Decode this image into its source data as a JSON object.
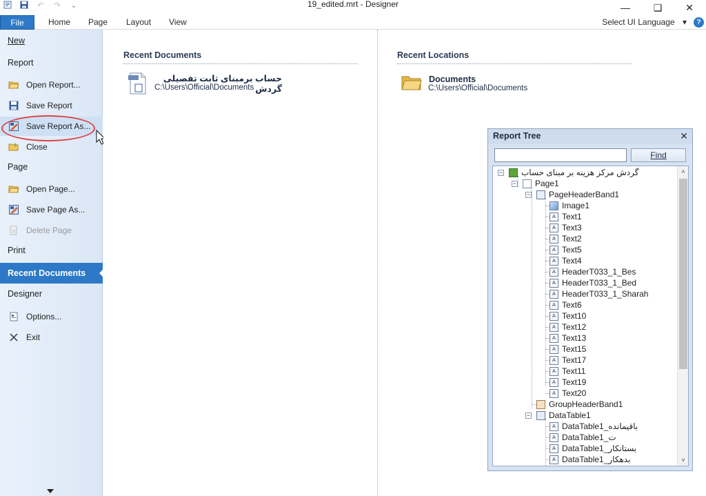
{
  "window": {
    "title": "19_edited.mrt  - Designer",
    "minimize_glyph": "—",
    "maximize_glyph": "❏",
    "close_glyph": "✕"
  },
  "qat": {
    "save_icon": "save-icon",
    "undo_icon": "undo-icon",
    "redo_icon": "redo-icon",
    "customize_glyph": "⌄"
  },
  "ribbon": {
    "tabs": [
      {
        "label": "File"
      },
      {
        "label": "Home"
      },
      {
        "label": "Page"
      },
      {
        "label": "Layout"
      },
      {
        "label": "View"
      }
    ],
    "ui_language": "Select UI Language",
    "ui_language_arrow": "▾",
    "help": "?"
  },
  "backstage": {
    "new": "New",
    "report_header": "Report",
    "open_report": "Open Report...",
    "save_report": "Save Report",
    "save_report_as": "Save Report As...",
    "close": "Close",
    "page_header": "Page",
    "open_page": "Open Page...",
    "save_page_as": "Save Page As...",
    "delete_page": "Delete Page",
    "print": "Print",
    "recent_documents": "Recent Documents",
    "designer_header": "Designer",
    "options": "Options...",
    "exit": "Exit"
  },
  "recent_documents": {
    "title": "Recent Documents",
    "items": [
      {
        "name": "حساب برمبنای ثابت تفصیلی گردش",
        "path": "C:\\Users\\Official\\Documents"
      }
    ]
  },
  "recent_locations": {
    "title": "Recent Locations",
    "items": [
      {
        "name": "Documents",
        "path": "C:\\Users\\Official\\Documents"
      }
    ]
  },
  "report_tree": {
    "title": "Report Tree",
    "close_glyph": "✕",
    "search_value": "",
    "find_label": "Find",
    "nodes": {
      "root": "گردش مرکز هزینه بر مبنای حساب",
      "page1": "Page1",
      "page_header_band": "PageHeaderBand1",
      "image1": "Image1",
      "text1": "Text1",
      "text3": "Text3",
      "text2": "Text2",
      "text5": "Text5",
      "text4": "Text4",
      "header_bes": "HeaderT033_1_Bes",
      "header_bed": "HeaderT033_1_Bed",
      "header_sharah": "HeaderT033_1_Sharah",
      "text6": "Text6",
      "text10": "Text10",
      "text12": "Text12",
      "text13": "Text13",
      "text15": "Text15",
      "text17": "Text17",
      "text11": "Text11",
      "text19": "Text19",
      "text20": "Text20",
      "group_header_band": "GroupHeaderBand1",
      "data_table": "DataTable1",
      "dt_baghimande": "DataTable1_باقیمانده",
      "dt_t": "DataTable1_ت",
      "dt_bestankar": "DataTable1_بستانکار",
      "dt_bedehkar": "DataTable1_بدهکار"
    }
  },
  "colors": {
    "accent": "#2d79c7",
    "highlight_ring": "#d94444",
    "backstage_bg": "#dbe7f6"
  }
}
